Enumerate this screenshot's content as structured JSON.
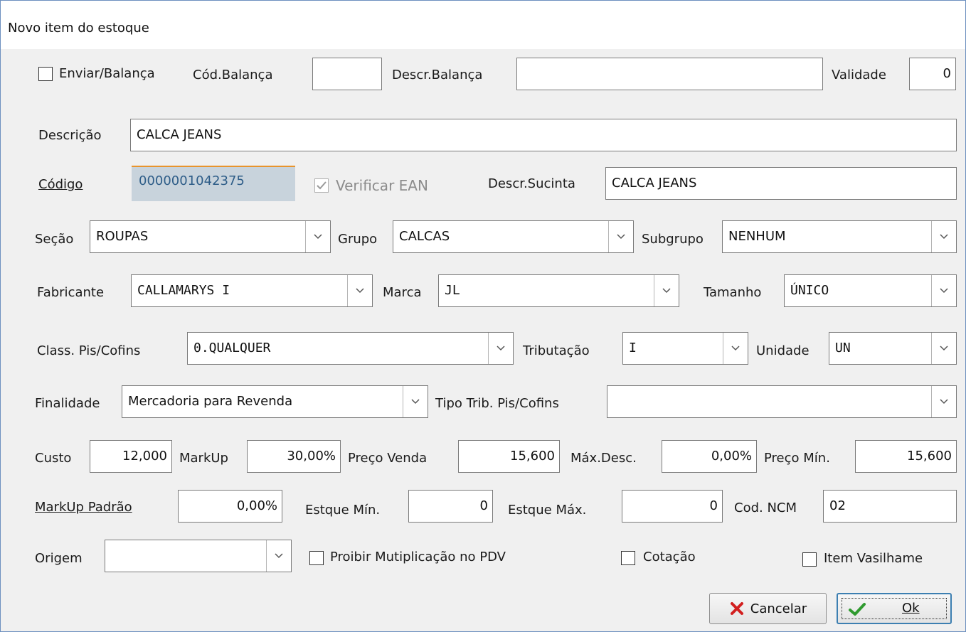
{
  "window": {
    "title": "Novo item do estoque"
  },
  "row1": {
    "enviar_balanca_label": "Enviar/Balança",
    "enviar_balanca_checked": false,
    "cod_balanca_label": "Cód.Balança",
    "cod_balanca_value": "",
    "descr_balanca_label": "Descr.Balança",
    "descr_balanca_value": "",
    "validade_label": "Validade",
    "validade_value": "0"
  },
  "descricao": {
    "label": "Descrição",
    "value": "CALCA JEANS"
  },
  "codigo": {
    "label": "Código",
    "value": "0000001042375",
    "verificar_ean_label": "Verificar EAN",
    "verificar_ean_checked": true,
    "descr_sucinta_label": "Descr.Sucinta",
    "descr_sucinta_value": "CALCA JEANS"
  },
  "classificacao": {
    "secao_label": "Seção",
    "secao_value": "ROUPAS",
    "grupo_label": "Grupo",
    "grupo_value": "CALCAS",
    "subgrupo_label": "Subgrupo",
    "subgrupo_value": "NENHUM"
  },
  "fabricacao": {
    "fabricante_label": "Fabricante",
    "fabricante_value": "CALLAMARYS I",
    "marca_label": "Marca",
    "marca_value": "JL",
    "tamanho_label": "Tamanho",
    "tamanho_value": "ÚNICO"
  },
  "fiscal": {
    "pis_cofins_label": "Class. Pis/Cofins",
    "pis_cofins_value": "0.QUALQUER",
    "tributacao_label": "Tributação",
    "tributacao_value": "I",
    "unidade_label": "Unidade",
    "unidade_value": "UN"
  },
  "finalidade": {
    "label": "Finalidade",
    "value": "Mercadoria para Revenda",
    "tipo_trib_label": "Tipo Trib. Pis/Cofins",
    "tipo_trib_value": ""
  },
  "precos": {
    "custo_label": "Custo",
    "custo_value": "12,000",
    "markup_label": "MarkUp",
    "markup_value": "30,00%",
    "preco_venda_label": "Preço Venda",
    "preco_venda_value": "15,600",
    "max_desc_label": "Máx.Desc.",
    "max_desc_value": "0,00%",
    "preco_min_label": "Preço Mín.",
    "preco_min_value": "15,600"
  },
  "estoque": {
    "markup_padrao_label": "MarkUp Padrão",
    "markup_padrao_value": "0,00%",
    "estoque_min_label": "Estque Mín.",
    "estoque_min_value": "0",
    "estoque_max_label": "Estque Máx.",
    "estoque_max_value": "0",
    "cod_ncm_label": "Cod. NCM",
    "cod_ncm_value": "02"
  },
  "opcoes": {
    "origem_label": "Origem",
    "origem_value": "",
    "proibir_label": "Proibir Mutiplicação no PDV",
    "proibir_checked": false,
    "cotacao_label": "Cotação",
    "cotacao_checked": false,
    "vasilhame_label": "Item Vasilhame",
    "vasilhame_checked": false
  },
  "buttons": {
    "cancelar_label": "Cancelar",
    "ok_label": "Ok"
  },
  "colors": {
    "accent_orange": "#e8942c",
    "code_text": "#2e5d88",
    "cancel_icon": "#d21f1f",
    "ok_icon": "#2f9a2f"
  }
}
